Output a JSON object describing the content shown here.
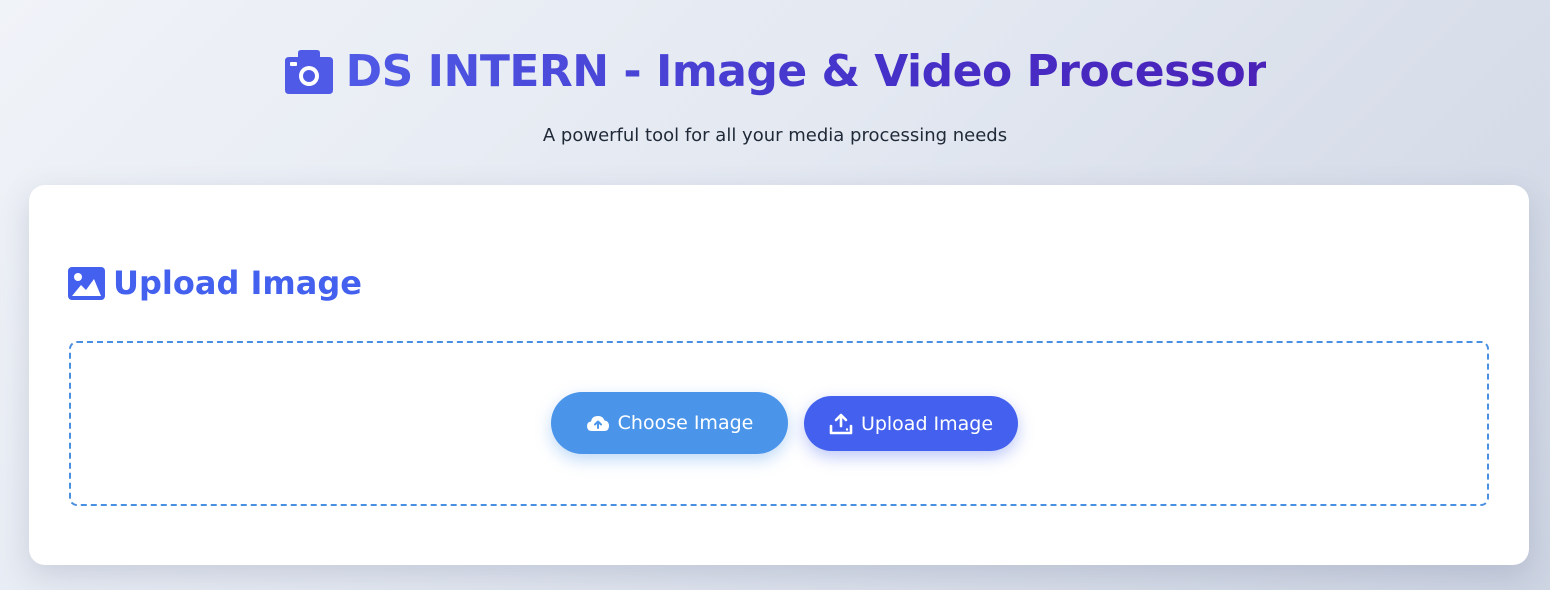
{
  "header": {
    "title": "DS INTERN - Image & Video Processor",
    "title_icon": "camera-icon",
    "subtitle": "A powerful tool for all your media processing needs"
  },
  "upload_section": {
    "title": "Upload Image",
    "title_icon": "image-icon",
    "choose_button": {
      "label": "Choose Image",
      "icon": "cloud-upload-icon"
    },
    "upload_button": {
      "label": "Upload Image",
      "icon": "upload-icon"
    }
  },
  "colors": {
    "accent": "#4361ee",
    "choose_button": "#4a95ea",
    "title_gradient_start": "#4f5ae6",
    "title_gradient_end": "#4a22b8",
    "dropzone_border": "#4a90e2"
  }
}
